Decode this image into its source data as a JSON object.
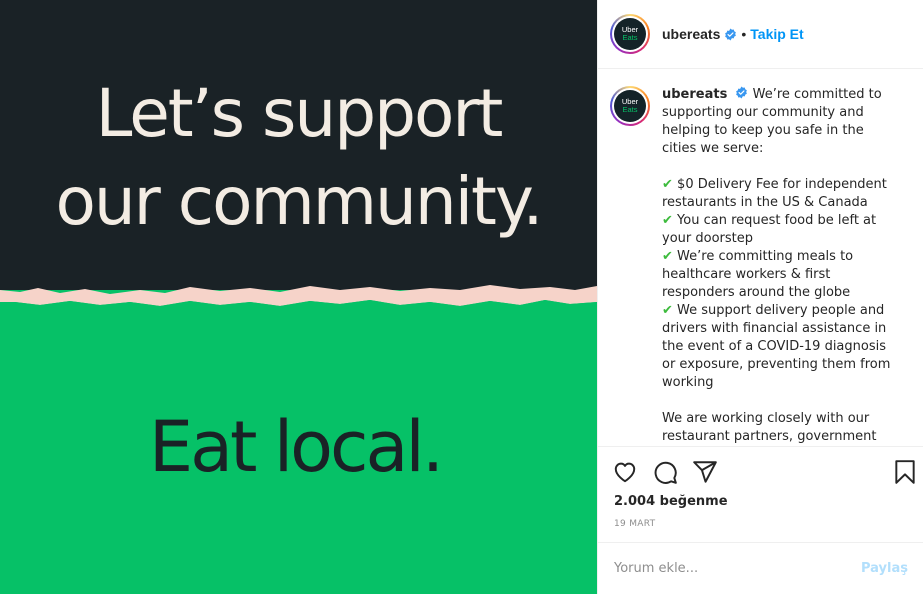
{
  "image": {
    "headline_line1": "Let’s support",
    "headline_line2": "our community.",
    "tagline": "Eat local.",
    "colors": {
      "dark": "#1a2226",
      "green": "#06c167",
      "tear": "#f6d3c9",
      "cream": "#f3ece3"
    }
  },
  "header": {
    "username": "ubereats",
    "dot": "•",
    "follow_label": "Takip Et",
    "logo_line1": "Uber",
    "logo_line2": "Eats"
  },
  "caption": {
    "username": "ubereats",
    "intro": "We’re committed to supporting our community and helping to keep you safe in the cities we serve:",
    "items": [
      "$0 Delivery Fee for independent restaurants in the US & Canada",
      "You can request food be left at your doorstep",
      "We’re committing meals to healthcare workers & first responders around the globe",
      "We support delivery people and drivers with financial assistance in the event of a COVID-19 diagnosis or exposure, preventing them from working"
    ],
    "check_glyph": "✔",
    "outro": "We are working closely with our restaurant partners, government"
  },
  "engagement": {
    "likes": "2.004 beğenme",
    "date": "19 MART"
  },
  "comment": {
    "placeholder": "Yorum ekle...",
    "share_label": "Paylaş"
  },
  "icons": [
    "heart-icon",
    "comment-icon",
    "share-icon",
    "bookmark-icon",
    "verified-icon"
  ]
}
